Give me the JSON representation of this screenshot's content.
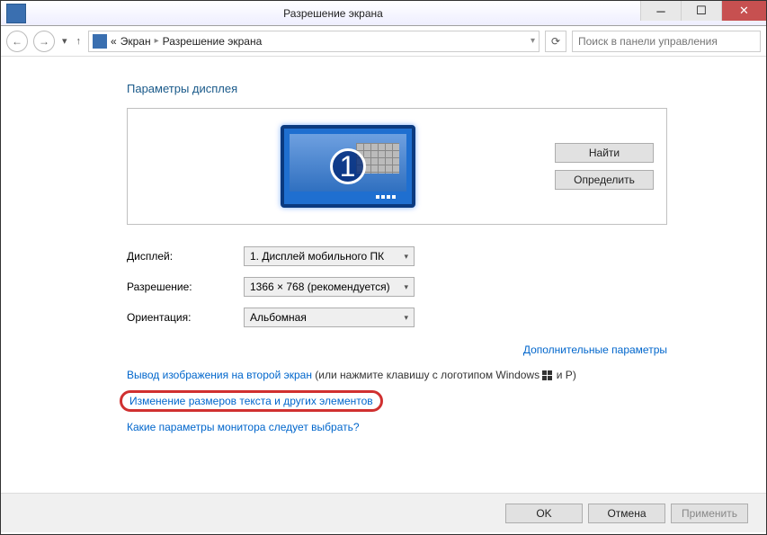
{
  "titlebar": {
    "title": "Разрешение экрана"
  },
  "nav": {
    "breadcrumb_prefix": "«",
    "breadcrumb1": "Экран",
    "breadcrumb2": "Разрешение экрана",
    "search_placeholder": "Поиск в панели управления"
  },
  "heading": "Параметры дисплея",
  "monitor": {
    "number": "1"
  },
  "panel_buttons": {
    "find": "Найти",
    "identify": "Определить"
  },
  "fields": {
    "display_label": "Дисплей:",
    "display_value": "1. Дисплей мобильного ПК",
    "resolution_label": "Разрешение:",
    "resolution_value": "1366 × 768 (рекомендуется)",
    "orientation_label": "Ориентация:",
    "orientation_value": "Альбомная"
  },
  "links": {
    "advanced": "Дополнительные параметры",
    "second_screen_link": "Вывод изображения на второй экран",
    "second_screen_hint": " (или нажмите клавишу с логотипом Windows ",
    "second_screen_hint_tail": " и P)",
    "resize_text": "Изменение размеров текста и других элементов",
    "which_settings": "Какие параметры монитора следует выбрать?"
  },
  "footer": {
    "ok": "OK",
    "cancel": "Отмена",
    "apply": "Применить"
  }
}
